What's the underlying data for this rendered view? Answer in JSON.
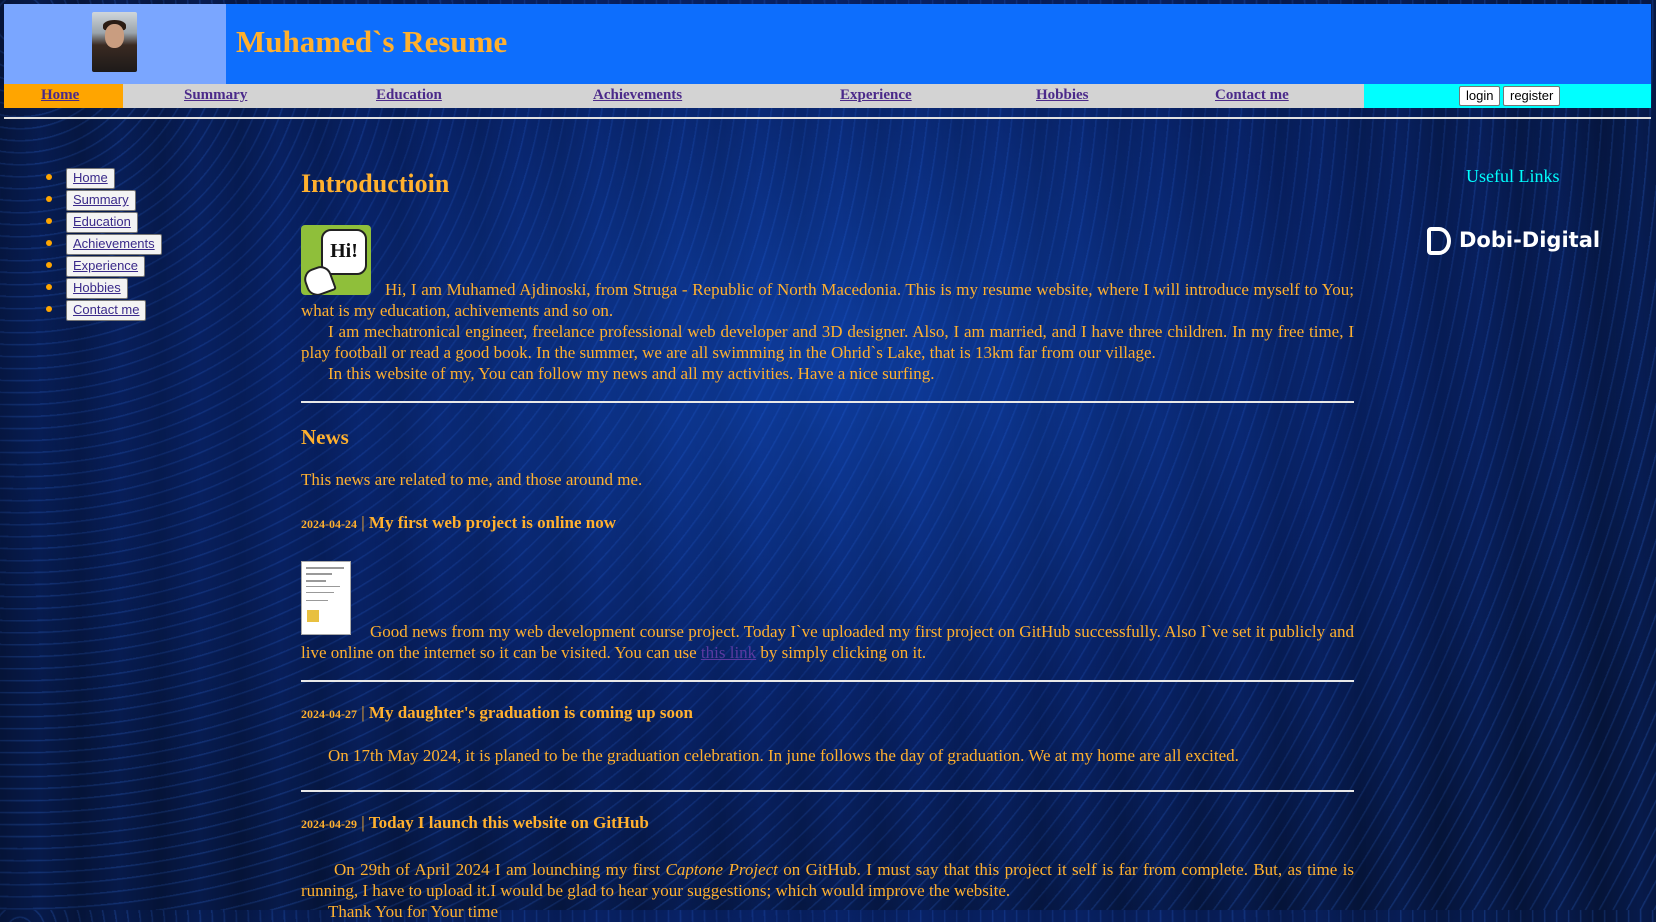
{
  "header": {
    "title": "Muhamed`s Resume",
    "avatar": "profile-photo"
  },
  "nav": {
    "items": [
      {
        "label": "Home"
      },
      {
        "label": "Summary"
      },
      {
        "label": "Education"
      },
      {
        "label": "Achievements"
      },
      {
        "label": "Experience"
      },
      {
        "label": "Hobbies"
      },
      {
        "label": "Contact me"
      }
    ],
    "login": "login",
    "register": "register"
  },
  "sidebar": {
    "items": [
      {
        "label": "Home"
      },
      {
        "label": "Summary"
      },
      {
        "label": "Education"
      },
      {
        "label": "Achievements"
      },
      {
        "label": "Experience"
      },
      {
        "label": "Hobbies"
      },
      {
        "label": "Contact me"
      }
    ]
  },
  "intro": {
    "heading": "Introductioin",
    "icon": "Hi!",
    "p1": "Hi, I am Muhamed Ajdinoski, from Struga - Republic of North Macedonia. This is my resume website, where I will introduce myself to You; what is my education, achivements and so on.",
    "p2": "I am mechatronical engineer, freelance professional web developer and 3D designer. Also, I am married, and I have three children. In my free time, I play football or read a good book. In the summer, we are all swimming in the Ohrid`s Lake, that is 13km far from our village.",
    "p3": "In this website of my, You can follow my news and all my activities. Have a nice surfing."
  },
  "news": {
    "heading": "News",
    "subtitle": "This news are related to me, and those around me.",
    "separator": " | ",
    "items": [
      {
        "date": "2024-04-24",
        "title": "My first web project is online now",
        "text_before": "Good news from my web development course project. Today I`ve uploaded my first project on GitHub successfully. Also I`ve set it publicly and live online on the internet so it can be visited. You can use ",
        "link": "this link",
        "text_after": " by simply clicking on it."
      },
      {
        "date": "2024-04-27",
        "title": "My daughter's graduation is coming up soon",
        "text": "On 17th May 2024, it is planed to be the graduation celebration. In june follows the day of graduation. We at my home are all excited."
      },
      {
        "date": "2024-04-29",
        "title": "Today I launch this website on GitHub",
        "text_before": "On 29th of April 2024 I am lounching my first ",
        "em": "Captone Project",
        "text_after": " on GitHub. I must say that this project it self is far from complete. But, as time is running, I have to upload it.I would be glad to hear your suggestions; which would improve the website.",
        "text_cut": "Thank You for Your time"
      }
    ]
  },
  "aside": {
    "heading": "Useful Links",
    "brand": "Dobi-Digital"
  }
}
